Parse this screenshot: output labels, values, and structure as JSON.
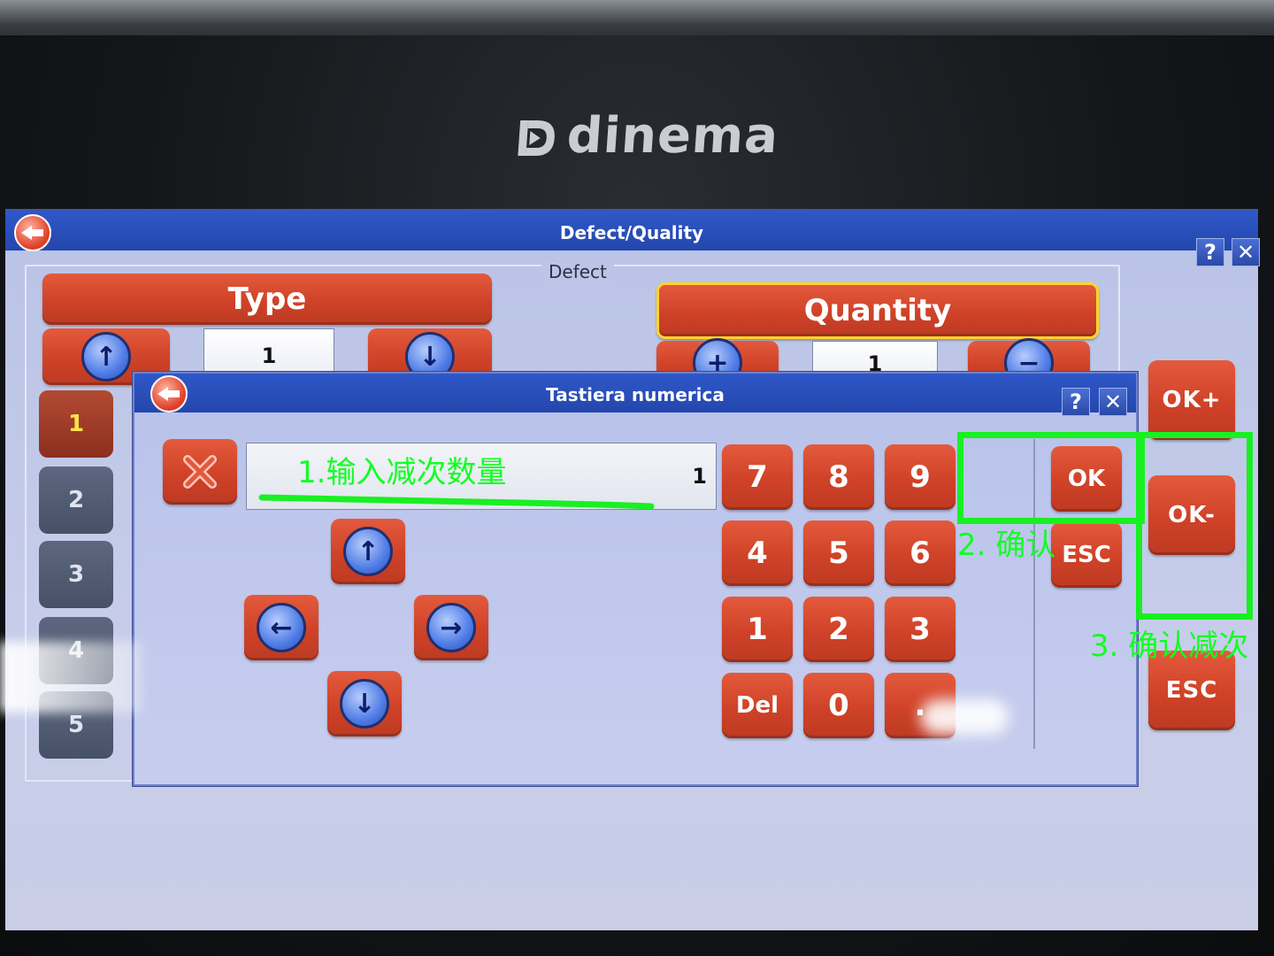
{
  "brand": {
    "logo_text": "dinema"
  },
  "main_window": {
    "title": "Defect/Quality",
    "help_label": "?",
    "close_label": "✕",
    "group_legend": "Defect",
    "type": {
      "label": "Type",
      "value": "1"
    },
    "quantity": {
      "label": "Quantity",
      "value": "1"
    },
    "type_tabs": [
      "1",
      "2",
      "3",
      "4",
      "5"
    ],
    "side_buttons": {
      "ok_plus": "OK+",
      "ok_minus": "OK-",
      "esc": "ESC"
    }
  },
  "keypad_dialog": {
    "title": "Tastiera numerica",
    "help_label": "?",
    "close_label": "✕",
    "display_value": "1",
    "keys": [
      "7",
      "8",
      "9",
      "4",
      "5",
      "6",
      "1",
      "2",
      "3",
      "Del",
      "0",
      "."
    ],
    "ok_label": "OK",
    "esc_label": "ESC"
  },
  "annotations": {
    "step1": "1.输入减次数量",
    "step2": "2. 确认",
    "step3": "3. 确认减次",
    "highlight_color": "#18f021"
  },
  "icons": {
    "back": "back-arrow-icon",
    "up": "arrow-up-icon",
    "down": "arrow-down-icon",
    "left": "arrow-left-icon",
    "right": "arrow-right-icon",
    "plus": "plus-icon",
    "minus": "minus-icon",
    "clear": "clear-x-icon"
  }
}
